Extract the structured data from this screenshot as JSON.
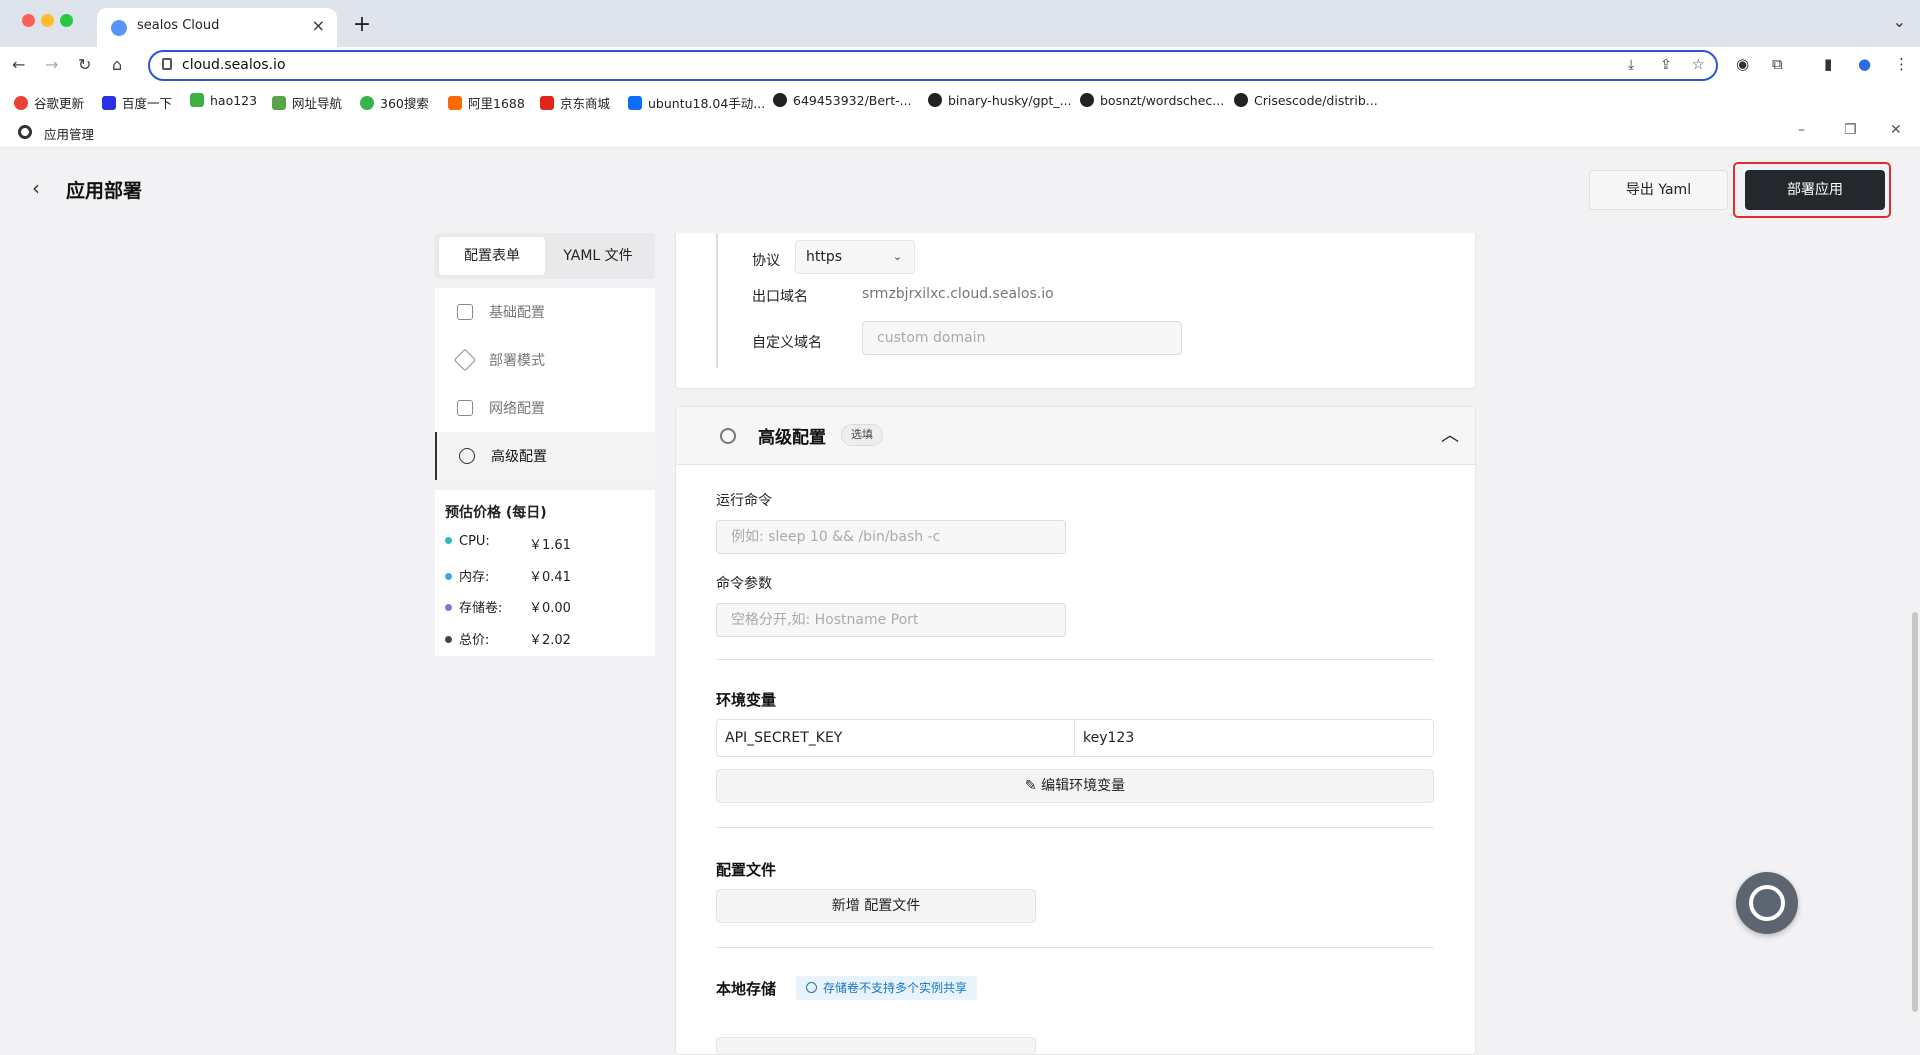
{
  "browser": {
    "tab_title": "sealos Cloud",
    "url": "cloud.sealos.io",
    "new_tab_label": "+",
    "bookmarks": [
      "谷歌更新",
      "百度一下",
      "hao123",
      "网址导航",
      "360搜索",
      "阿里1688",
      "京东商城",
      "ubuntu18.04手动...",
      "649453932/Bert-...",
      "binary-husky/gpt_...",
      "bosnzt/wordschec...",
      "Crisescode/distrib..."
    ]
  },
  "app": {
    "name": "应用管理",
    "page_title": "应用部署",
    "export_label": "导出 Yaml",
    "deploy_label": "部署应用"
  },
  "left": {
    "tabs": [
      "配置表单",
      "YAML 文件"
    ],
    "nav": [
      "基础配置",
      "部署模式",
      "网络配置",
      "高级配置"
    ],
    "price_title": "预估价格 (每日)",
    "prices": [
      {
        "label": "CPU:",
        "value": "￥1.61",
        "color": "#33b9b0"
      },
      {
        "label": "内存:",
        "value": "￥0.41",
        "color": "#36a9e8"
      },
      {
        "label": "存储卷:",
        "value": "￥0.00",
        "color": "#8e6fd6"
      },
      {
        "label": "总价:",
        "value": "￥2.02",
        "color": "#444444"
      }
    ]
  },
  "network": {
    "protocol_label": "协议",
    "protocol_value": "https",
    "export_domain_label": "出口域名",
    "export_domain_value": "srmzbjrxilxc.cloud.sealos.io",
    "custom_domain_label": "自定义域名",
    "custom_domain_placeholder": "custom domain"
  },
  "advanced": {
    "title": "高级配置",
    "tag": "选填",
    "run_cmd_label": "运行命令",
    "run_cmd_placeholder": "例如: sleep 10 && /bin/bash -c",
    "args_label": "命令参数",
    "args_placeholder": "空格分开,如: Hostname Port",
    "env_title": "环境变量",
    "env_key": "API_SECRET_KEY",
    "env_value": "key123",
    "edit_env_label": "编辑环境变量",
    "config_file_title": "配置文件",
    "add_config_label": "新增 配置文件",
    "storage_title": "本地存储",
    "storage_notice": "存储卷不支持多个实例共享"
  }
}
